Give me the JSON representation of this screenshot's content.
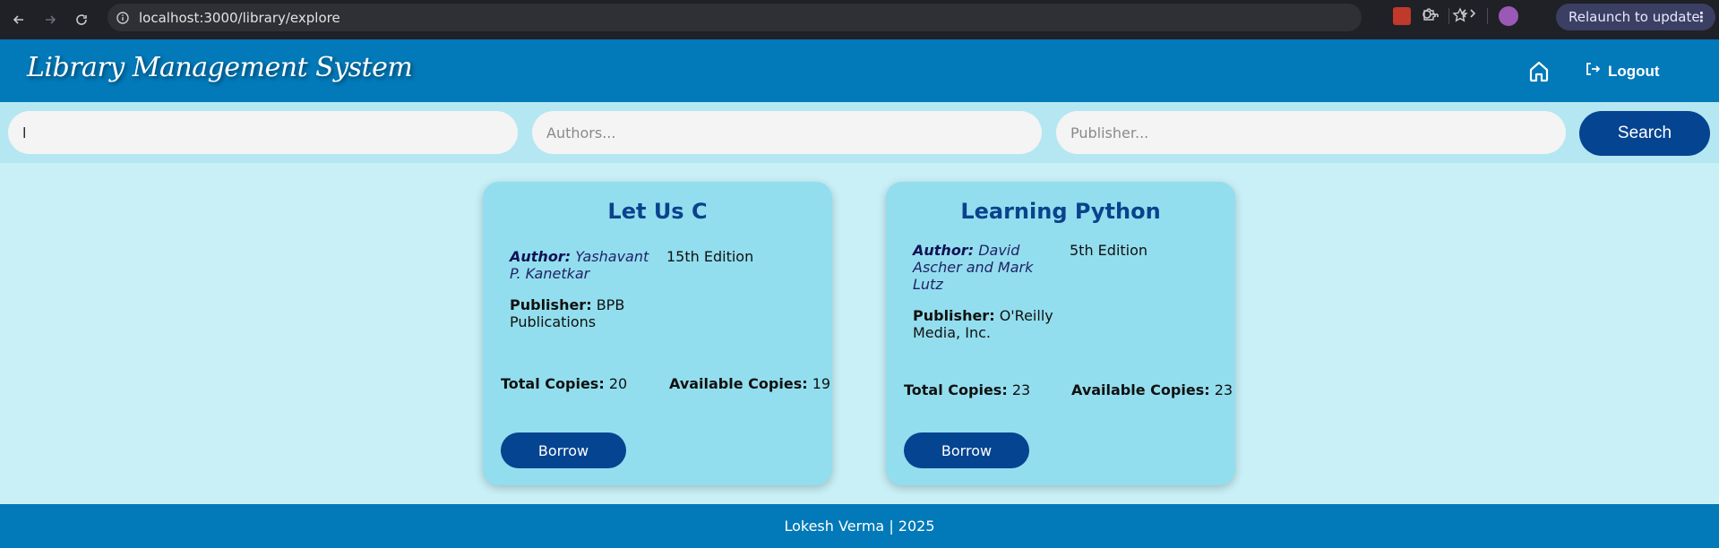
{
  "browser": {
    "url": "localhost:3000/library/explore",
    "relaunch_label": "Relaunch to update"
  },
  "header": {
    "brand": "Library Management System",
    "logout_label": "Logout"
  },
  "search": {
    "title_value": "l",
    "authors_placeholder": "Authors...",
    "publisher_placeholder": "Publisher...",
    "button_label": "Search"
  },
  "books": [
    {
      "title": "Let Us C",
      "author_label": "Author:",
      "author": "Yashavant P. Kanetkar",
      "edition": "15th Edition",
      "publisher_label": "Publisher:",
      "publisher": "BPB Publications",
      "total_label": "Total Copies:",
      "total": "20",
      "available_label": "Available Copies:",
      "available": "19",
      "borrow_label": "Borrow"
    },
    {
      "title": "Learning Python",
      "author_label": "Author:",
      "author": "David Ascher and Mark Lutz",
      "edition": "5th Edition",
      "publisher_label": "Publisher:",
      "publisher": "O'Reilly Media, Inc.",
      "total_label": "Total Copies:",
      "total": "23",
      "available_label": "Available Copies:",
      "available": "23",
      "borrow_label": "Borrow"
    }
  ],
  "footer": {
    "text": "Lokesh Verma | 2025"
  },
  "colors": {
    "header": "#0279b8",
    "button": "#054490",
    "card": "#92deee",
    "page": "#c9f0f7"
  }
}
